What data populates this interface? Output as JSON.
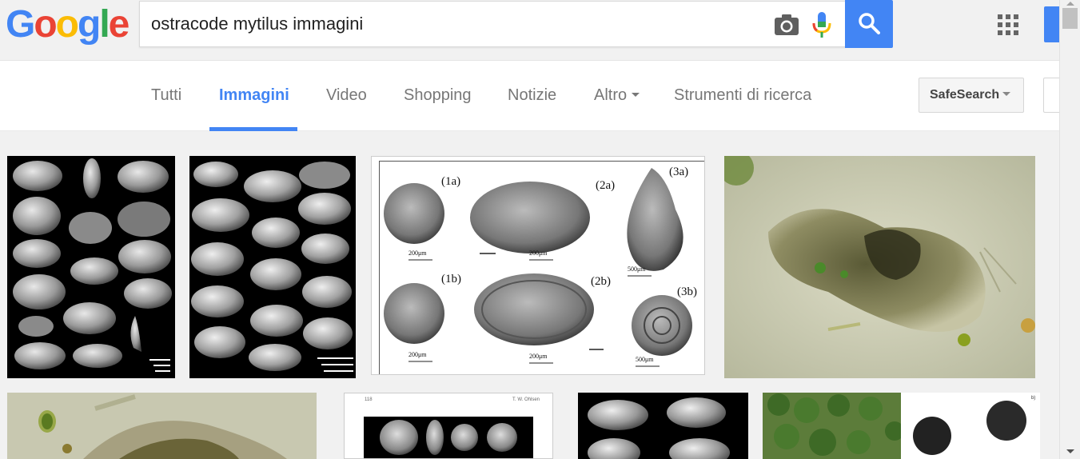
{
  "logo": {
    "letters": [
      "G",
      "o",
      "o",
      "g",
      "l",
      "e"
    ],
    "colors": [
      "#4285f4",
      "#ea4335",
      "#fbbc05",
      "#4285f4",
      "#34a853",
      "#ea4335"
    ]
  },
  "search": {
    "query": "ostracode mytilus immagini"
  },
  "icons": {
    "camera": "camera-icon",
    "mic": "microphone-icon",
    "search": "search-icon",
    "apps": "apps-grid-icon"
  },
  "accent_color": "#4285f4",
  "nav": {
    "tabs": [
      {
        "label": "Tutti",
        "active": false
      },
      {
        "label": "Immagini",
        "active": true
      },
      {
        "label": "Video",
        "active": false
      },
      {
        "label": "Shopping",
        "active": false
      },
      {
        "label": "Notizie",
        "active": false
      },
      {
        "label": "Altro",
        "active": false,
        "dropdown": true
      },
      {
        "label": "Strumenti di ricerca",
        "active": false
      }
    ],
    "safesearch_label": "SafeSearch"
  },
  "results": {
    "figure_labels": [
      "(1a)",
      "(2a)",
      "(3a)",
      "(1b)",
      "(2b)",
      "(3b)"
    ],
    "scale_labels": [
      "200μm",
      "200μm",
      "500μm",
      "200μm",
      "200μm",
      "500μm"
    ],
    "page_header_left": "118",
    "page_header_right": "T. W. Ohlsen",
    "panel_label": "b)"
  }
}
